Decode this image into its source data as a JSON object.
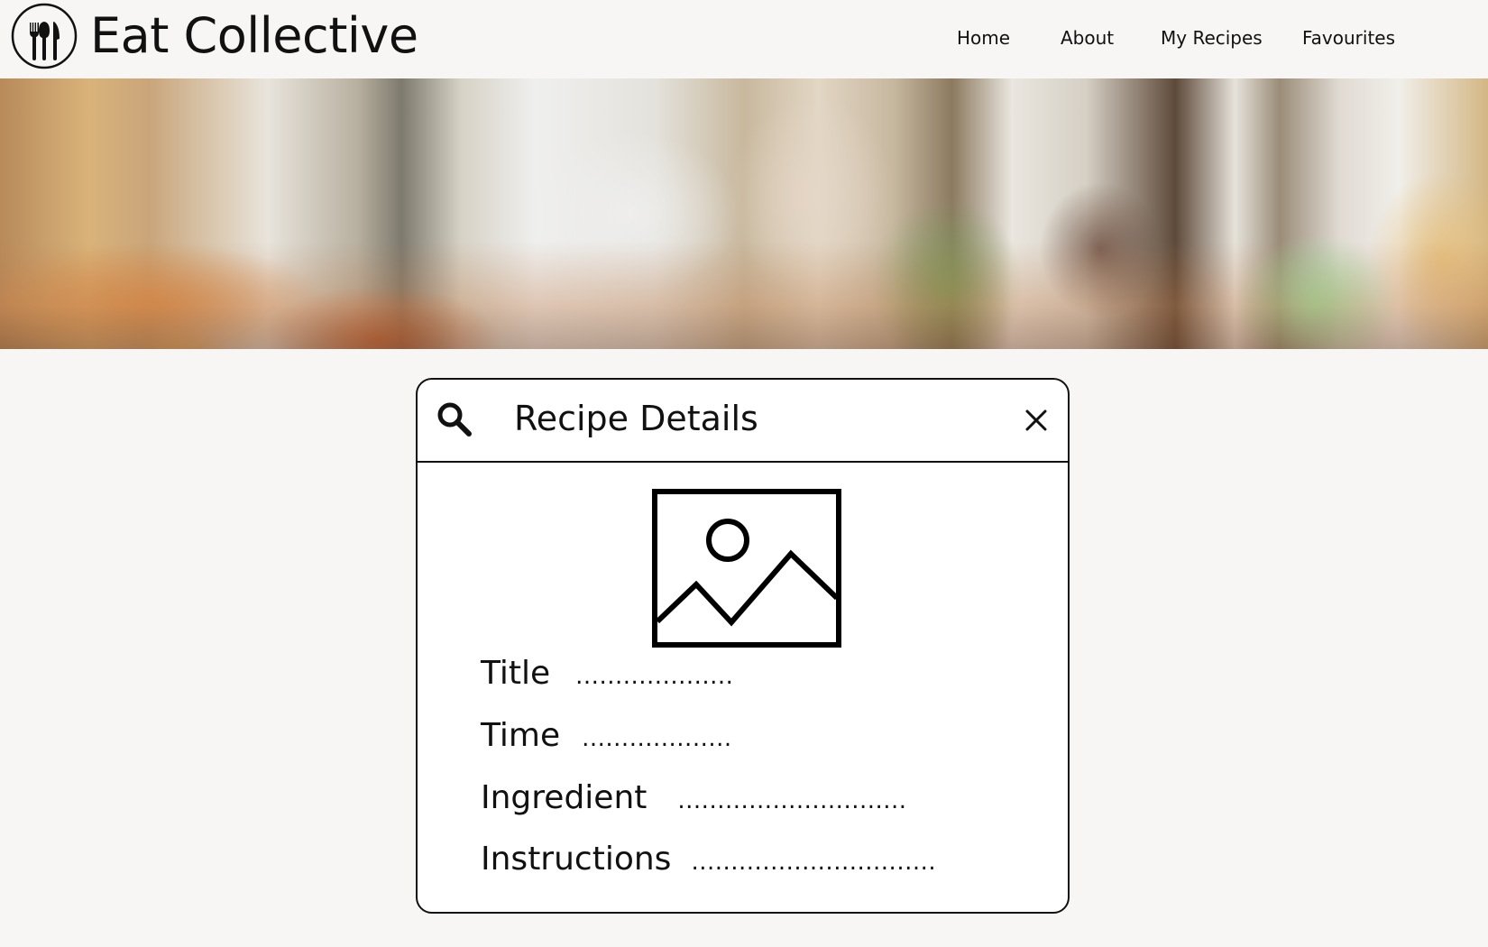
{
  "app": {
    "title": "Eat Collective"
  },
  "nav": {
    "items": [
      {
        "label": "Home"
      },
      {
        "label": "About"
      },
      {
        "label": "My Recipes"
      },
      {
        "label": "Favourites"
      }
    ]
  },
  "hero": {
    "description": "blurred restaurant background"
  },
  "modal": {
    "title": "Recipe Details",
    "search_icon": "search-icon",
    "close_icon": "close-icon",
    "image_icon": "image-placeholder-icon",
    "fields": [
      {
        "label": "Title",
        "value": "...................."
      },
      {
        "label": "Time",
        "value": "..................."
      },
      {
        "label": "Ingredient",
        "value": "............................."
      },
      {
        "label": "Instructions",
        "value": "..............................."
      }
    ]
  },
  "colors": {
    "background": "#f7f6f4",
    "text": "#111111",
    "modal_background": "#ffffff"
  }
}
